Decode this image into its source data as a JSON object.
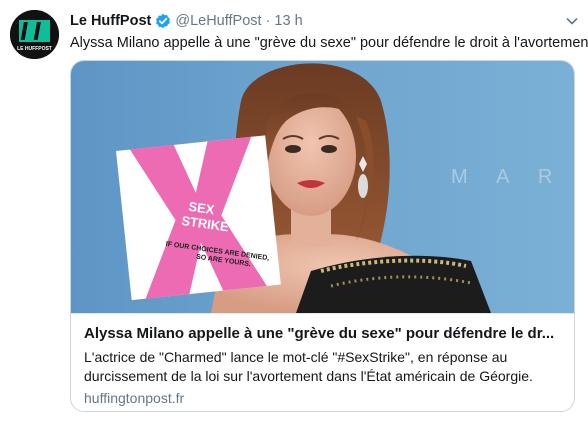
{
  "account": {
    "name": "Le HuffPost",
    "handle": "@LeHuffPost",
    "separator": "·",
    "time": "13 h",
    "verified_color": "#1da1f2",
    "avatar_logo_text": "LE HUFFPOST",
    "avatar_color": "#111111",
    "brand_green": "#0dbe98"
  },
  "tweet": {
    "text": "Alyssa Milano appelle à une \"grève du sexe\" pour défendre le droit à l'avortement"
  },
  "card": {
    "title": "Alyssa Milano appelle à une \"grève du sexe\" pour défendre le dr...",
    "description": "L'actrice de \"Charmed\" lance le mot-clé \"#SexStrike\", en réponse au durcissement de la loi sur l'avortement dans l'État américain de Géorgie.",
    "domain": "huffingtonpost.fr",
    "poster_line1": "SEX",
    "poster_line2": "STRIKE",
    "poster_line3": "IF OUR CHOICES ARE DENIED,",
    "poster_line4": "SO ARE YOURS.",
    "backdrop_text": "M A R",
    "backdrop_color": "#6fa4cc",
    "poster_x_color": "#ec6bb2"
  },
  "icons": {
    "verified": "verified-badge-icon",
    "caret": "chevron-down-icon"
  }
}
